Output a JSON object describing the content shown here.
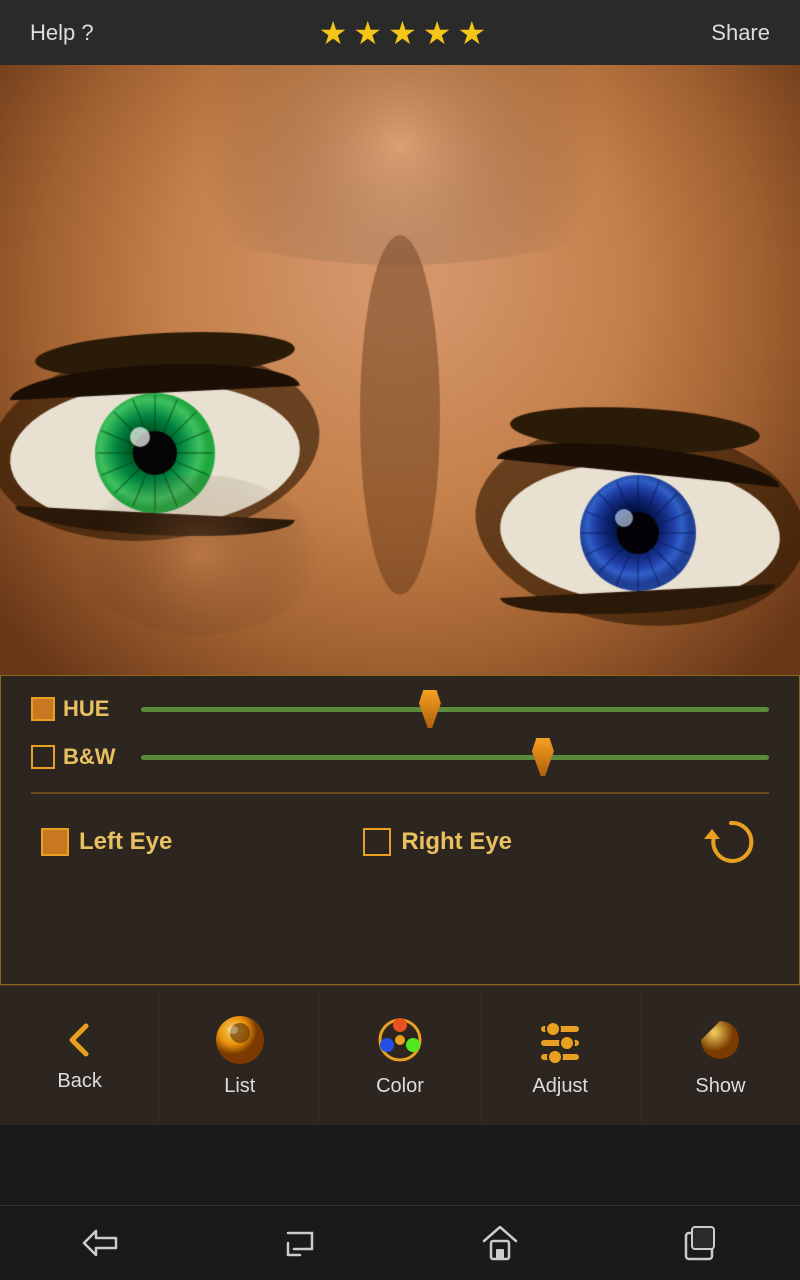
{
  "header": {
    "help_label": "Help ?",
    "share_label": "Share",
    "stars": [
      "★",
      "★",
      "★",
      "★",
      "★"
    ]
  },
  "sliders": {
    "hue": {
      "label": "HUE",
      "value": 46,
      "has_checkbox": true,
      "checkbox_filled": true
    },
    "bw": {
      "label": "B&W",
      "value": 64,
      "has_checkbox": true,
      "checkbox_filled": false
    }
  },
  "eye_selection": {
    "left_eye_label": "Left Eye",
    "right_eye_label": "Right Eye",
    "left_checked": true,
    "right_checked": false
  },
  "bottom_nav": {
    "items": [
      {
        "id": "back",
        "label": "Back",
        "icon": "back"
      },
      {
        "id": "list",
        "label": "List",
        "icon": "list"
      },
      {
        "id": "color",
        "label": "Color",
        "icon": "color"
      },
      {
        "id": "adjust",
        "label": "Adjust",
        "icon": "adjust"
      },
      {
        "id": "show",
        "label": "Show",
        "icon": "show"
      }
    ]
  },
  "sys_nav": {
    "back_icon": "⌂",
    "home_icon": "↩",
    "house_icon": "⌂",
    "square_icon": "▢"
  }
}
